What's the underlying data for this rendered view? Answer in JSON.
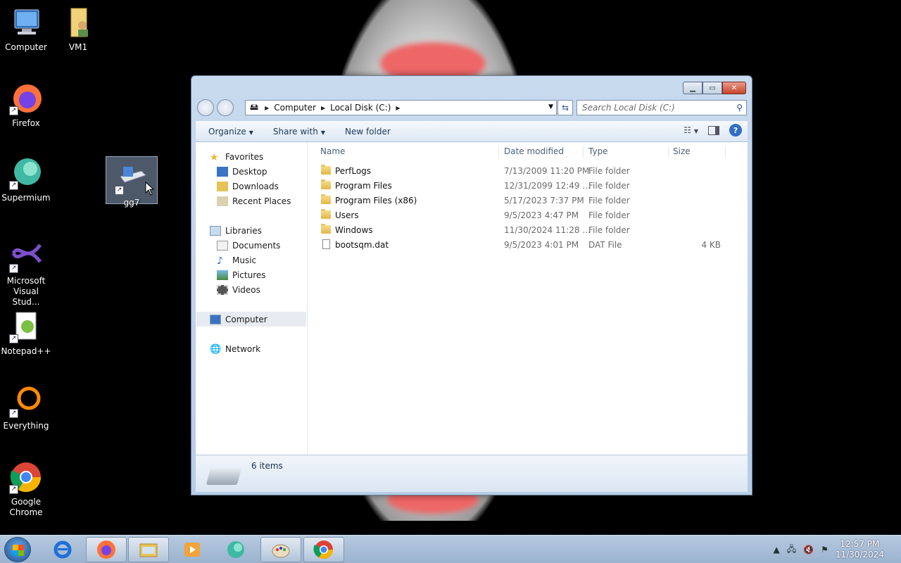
{
  "desktop": {
    "icons": [
      {
        "label": "Computer"
      },
      {
        "label": "VM1"
      },
      {
        "label": "Firefox"
      },
      {
        "label": "gg7"
      },
      {
        "label": "Supermium"
      },
      {
        "label": "Microsoft Visual Stud..."
      },
      {
        "label": "Notepad++"
      },
      {
        "label": "Everything"
      },
      {
        "label": "Google Chrome"
      }
    ]
  },
  "window": {
    "breadcrumb": [
      "Computer",
      "Local Disk (C:)"
    ],
    "search_placeholder": "Search Local Disk (C:)",
    "toolbar": {
      "organize": "Organize",
      "share_with": "Share with",
      "new_folder": "New folder"
    },
    "nav": {
      "favorites": "Favorites",
      "favorites_items": [
        "Desktop",
        "Downloads",
        "Recent Places"
      ],
      "libraries": "Libraries",
      "libraries_items": [
        "Documents",
        "Music",
        "Pictures",
        "Videos"
      ],
      "computer": "Computer",
      "network": "Network"
    },
    "columns": {
      "name": "Name",
      "date": "Date modified",
      "type": "Type",
      "size": "Size"
    },
    "files": [
      {
        "name": "PerfLogs",
        "date": "7/13/2009 11:20 PM",
        "type": "File folder",
        "size": "",
        "kind": "folder"
      },
      {
        "name": "Program Files",
        "date": "12/31/2099 12:49 ...",
        "type": "File folder",
        "size": "",
        "kind": "folder"
      },
      {
        "name": "Program Files (x86)",
        "date": "5/17/2023 7:37 PM",
        "type": "File folder",
        "size": "",
        "kind": "folder"
      },
      {
        "name": "Users",
        "date": "9/5/2023 4:47 PM",
        "type": "File folder",
        "size": "",
        "kind": "folder"
      },
      {
        "name": "Windows",
        "date": "11/30/2024 11:28 ...",
        "type": "File folder",
        "size": "",
        "kind": "folder"
      },
      {
        "name": "bootsqm.dat",
        "date": "9/5/2023 4:01 PM",
        "type": "DAT File",
        "size": "4 KB",
        "kind": "file"
      }
    ],
    "status_count": "6 items"
  },
  "taskbar": {
    "time": "12:57 PM",
    "date": "11/30/2024"
  }
}
